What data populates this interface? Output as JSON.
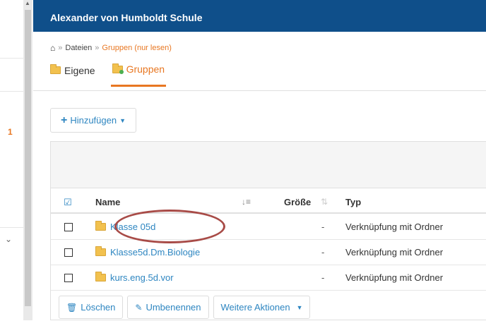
{
  "app": {
    "title": "Alexander von Humboldt Schule"
  },
  "sidebar": {
    "count_badge": "1"
  },
  "breadcrumb": {
    "items": [
      "Dateien",
      "Gruppen (nur lesen)"
    ],
    "separator": "»"
  },
  "tabs": [
    {
      "label": "Eigene",
      "active": false
    },
    {
      "label": "Gruppen",
      "active": true
    }
  ],
  "toolbar": {
    "add_label": "Hinzufügen"
  },
  "table": {
    "columns": {
      "name": "Name",
      "size": "Größe",
      "type": "Typ"
    },
    "rows": [
      {
        "name": "Klasse 05d",
        "size": "-",
        "type": "Verknüpfung mit Ordner"
      },
      {
        "name": "Klasse5d.Dm.Biologie",
        "size": "-",
        "type": "Verknüpfung mit Ordner"
      },
      {
        "name": "kurs.eng.5d.vor",
        "size": "-",
        "type": "Verknüpfung mit Ordner"
      }
    ]
  },
  "actions": {
    "delete": "Löschen",
    "rename": "Umbenennen",
    "more": "Weitere Aktionen"
  },
  "colors": {
    "header": "#0f4f8a",
    "accent": "#e87722",
    "link": "#2e86c1",
    "highlight_ring": "#a84b47"
  }
}
